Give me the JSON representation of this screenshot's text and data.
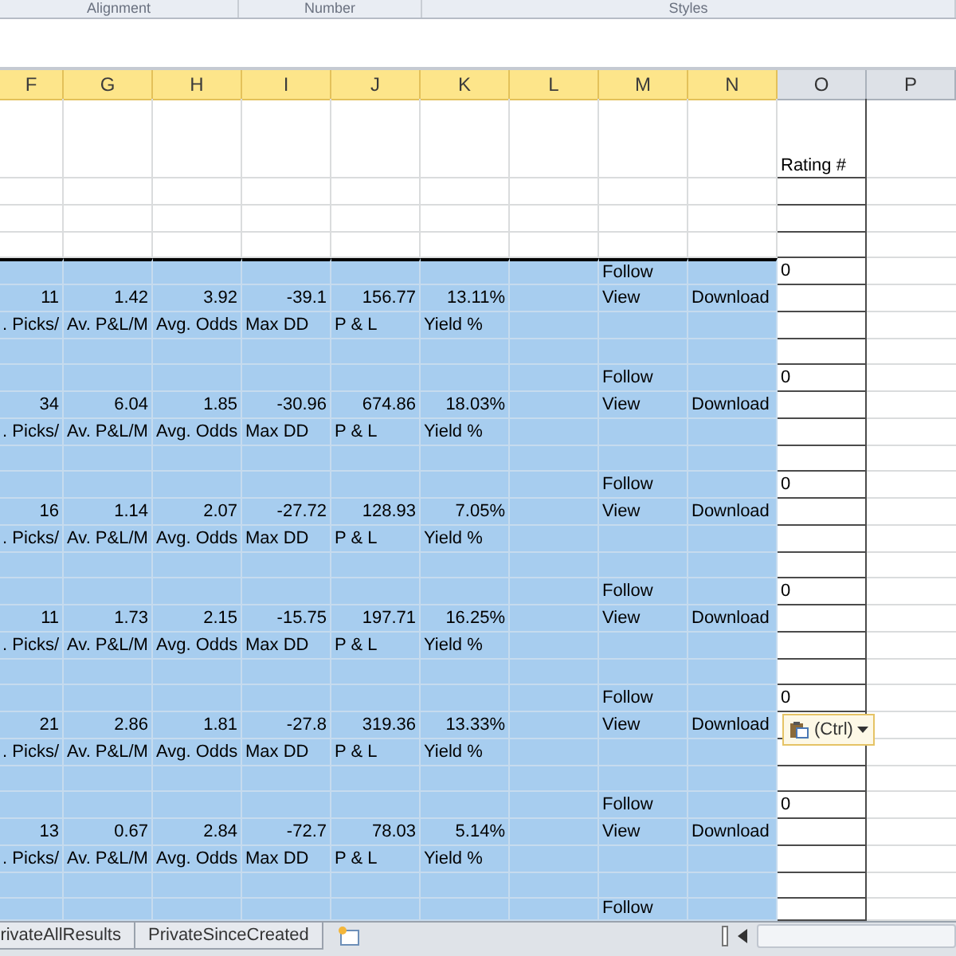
{
  "ribbon_groups": [
    "Alignment",
    "Number",
    "Styles"
  ],
  "columns": [
    {
      "label": "F",
      "selected": true
    },
    {
      "label": "G",
      "selected": true
    },
    {
      "label": "H",
      "selected": true
    },
    {
      "label": "I",
      "selected": true
    },
    {
      "label": "J",
      "selected": true
    },
    {
      "label": "K",
      "selected": true
    },
    {
      "label": "L",
      "selected": true
    },
    {
      "label": "M",
      "selected": true
    },
    {
      "label": "N",
      "selected": true
    },
    {
      "label": "O",
      "selected": false
    },
    {
      "label": "P",
      "selected": false
    }
  ],
  "header_cell": "Rating #",
  "records": [
    {
      "follow": "Follow",
      "rating": "0",
      "values": [
        "11",
        "1.42",
        "3.92",
        "-39.1",
        "156.77",
        "13.11%"
      ],
      "view": "View",
      "download": "Download",
      "labels": [
        ". Picks/",
        "Av. P&L/M",
        "Avg. Odds",
        "Max DD",
        "P & L",
        "Yield %"
      ]
    },
    {
      "follow": "Follow",
      "rating": "0",
      "values": [
        "34",
        "6.04",
        "1.85",
        "-30.96",
        "674.86",
        "18.03%"
      ],
      "view": "View",
      "download": "Download",
      "labels": [
        ". Picks/",
        "Av. P&L/M",
        "Avg. Odds",
        "Max DD",
        "P & L",
        "Yield %"
      ]
    },
    {
      "follow": "Follow",
      "rating": "0",
      "values": [
        "16",
        "1.14",
        "2.07",
        "-27.72",
        "128.93",
        "7.05%"
      ],
      "view": "View",
      "download": "Download",
      "labels": [
        ". Picks/",
        "Av. P&L/M",
        "Avg. Odds",
        "Max DD",
        "P & L",
        "Yield %"
      ]
    },
    {
      "follow": "Follow",
      "rating": "0",
      "values": [
        "11",
        "1.73",
        "2.15",
        "-15.75",
        "197.71",
        "16.25%"
      ],
      "view": "View",
      "download": "Download",
      "labels": [
        ". Picks/",
        "Av. P&L/M",
        "Avg. Odds",
        "Max DD",
        "P & L",
        "Yield %"
      ]
    },
    {
      "follow": "Follow",
      "rating": "0",
      "values": [
        "21",
        "2.86",
        "1.81",
        "-27.8",
        "319.36",
        "13.33%"
      ],
      "view": "View",
      "download": "Download",
      "labels": [
        ". Picks/",
        "Av. P&L/M",
        "Avg. Odds",
        "Max DD",
        "P & L",
        "Yield %"
      ]
    },
    {
      "follow": "Follow",
      "rating": "0",
      "values": [
        "13",
        "0.67",
        "2.84",
        "-72.7",
        "78.03",
        "5.14%"
      ],
      "view": "View",
      "download": "Download",
      "labels": [
        ". Picks/",
        "Av. P&L/M",
        "Avg. Odds",
        "Max DD",
        "P & L",
        "Yield %"
      ]
    }
  ],
  "partial_row": {
    "follow": "Follow"
  },
  "paste_options": "(Ctrl)",
  "sheet_tabs": [
    {
      "label": "rivateAllResults",
      "selected": false
    },
    {
      "label": "PrivateSinceCreated",
      "selected": false
    }
  ]
}
